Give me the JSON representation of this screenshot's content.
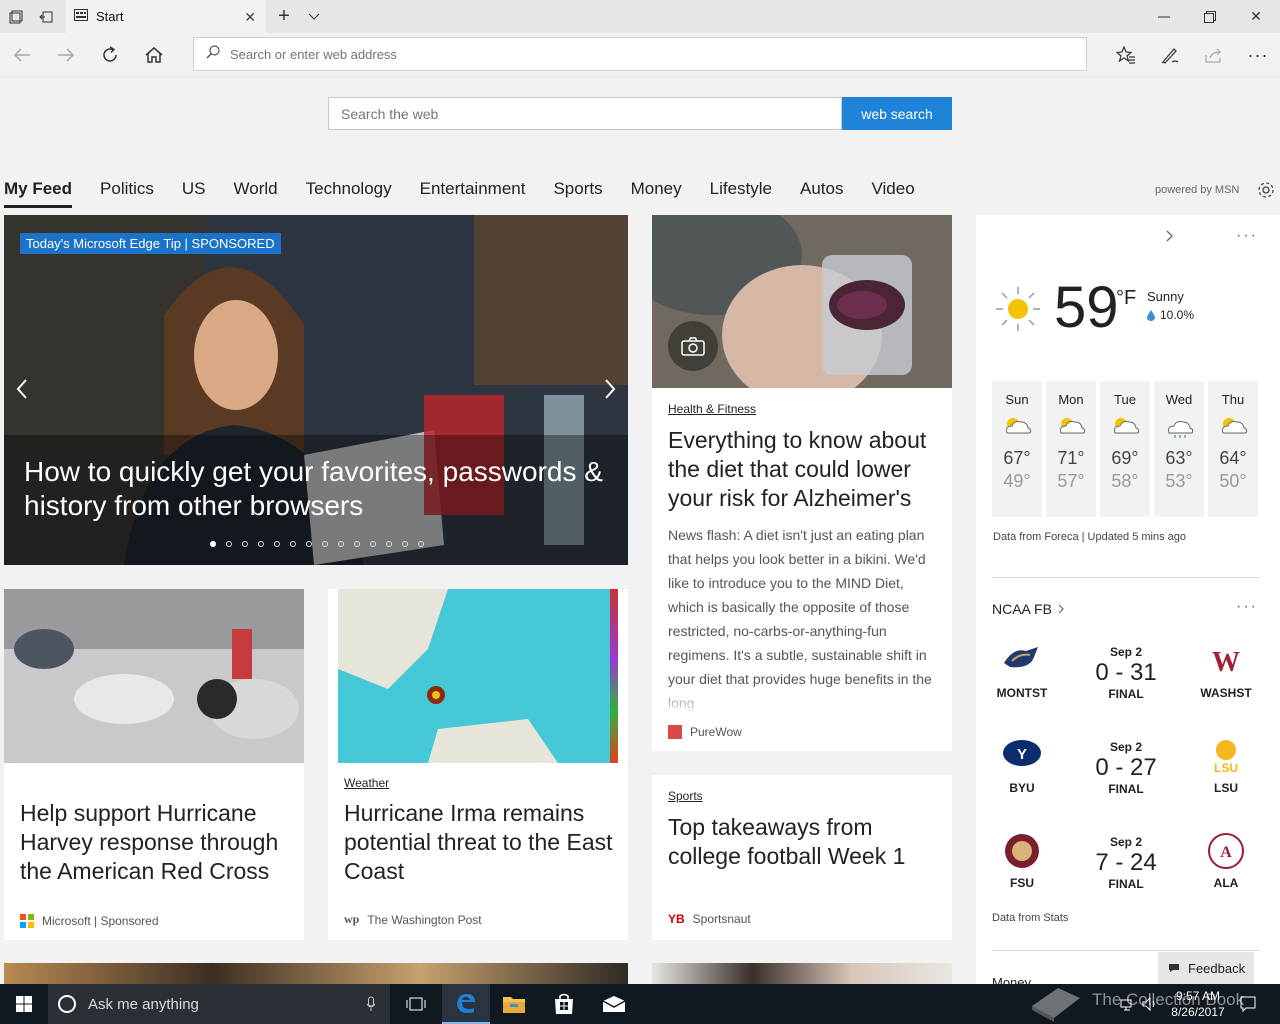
{
  "browser": {
    "tab_title": "Start",
    "address_placeholder": "Search or enter web address"
  },
  "search": {
    "placeholder": "Search the web",
    "button": "web search"
  },
  "categories": [
    "My Feed",
    "Politics",
    "US",
    "World",
    "Technology",
    "Entertainment",
    "Sports",
    "Money",
    "Lifestyle",
    "Autos",
    "Video"
  ],
  "powered_by": "powered by MSN",
  "hero": {
    "badge": "Today's Microsoft Edge Tip | SPONSORED",
    "title": "How to quickly get your favorites, passwords & history from other browsers",
    "dot_count": 14,
    "active_dot": 0
  },
  "article_health": {
    "tag": "Health & Fitness",
    "title": "Everything to know about the diet that could lower your risk for Alzheimer's",
    "snippet": "News flash: A diet isn't just an eating plan that helps you look better in a bikini. We'd like to introduce you to the MIND Diet, which is basically the opposite of those restricted, no-carbs-or-anything-fun regimens. It's a subtle, sustainable shift in your diet that provides huge benefits in the long",
    "source": "PureWow"
  },
  "article_redcross": {
    "title": "Help support Hurricane Harvey response through the American Red Cross",
    "source": "Microsoft | Sponsored"
  },
  "article_irma": {
    "tag": "Weather",
    "title": "Hurricane Irma remains potential threat to the East Coast",
    "source": "The Washington Post"
  },
  "article_football": {
    "tag": "Sports",
    "title": "Top takeaways from college football Week 1",
    "source": "Sportsnaut"
  },
  "weather": {
    "temp": "59",
    "unit": "°F",
    "condition": "Sunny",
    "precip": "10.0%",
    "days": [
      {
        "d": "Sun",
        "hi": "67°",
        "lo": "49°"
      },
      {
        "d": "Mon",
        "hi": "71°",
        "lo": "57°"
      },
      {
        "d": "Tue",
        "hi": "69°",
        "lo": "58°"
      },
      {
        "d": "Wed",
        "hi": "63°",
        "lo": "53°"
      },
      {
        "d": "Thu",
        "hi": "64°",
        "lo": "50°"
      }
    ],
    "footer": "Data from Foreca | Updated 5 mins ago"
  },
  "ncaa": {
    "title": "NCAA FB",
    "games": [
      {
        "home": "MONTST",
        "away": "WASHST",
        "date": "Sep 2",
        "score": "0 - 31",
        "status": "FINAL"
      },
      {
        "home": "BYU",
        "away": "LSU",
        "date": "Sep 2",
        "score": "0 - 27",
        "status": "FINAL"
      },
      {
        "home": "FSU",
        "away": "ALA",
        "date": "Sep 2",
        "score": "7 - 24",
        "status": "FINAL"
      }
    ],
    "footer": "Data from Stats",
    "next_label": "Money"
  },
  "feedback": "Feedback",
  "taskbar": {
    "cortana": "Ask me anything",
    "time": "9:57 AM",
    "date": "8/26/2017",
    "watermark": "The Collection Book"
  }
}
